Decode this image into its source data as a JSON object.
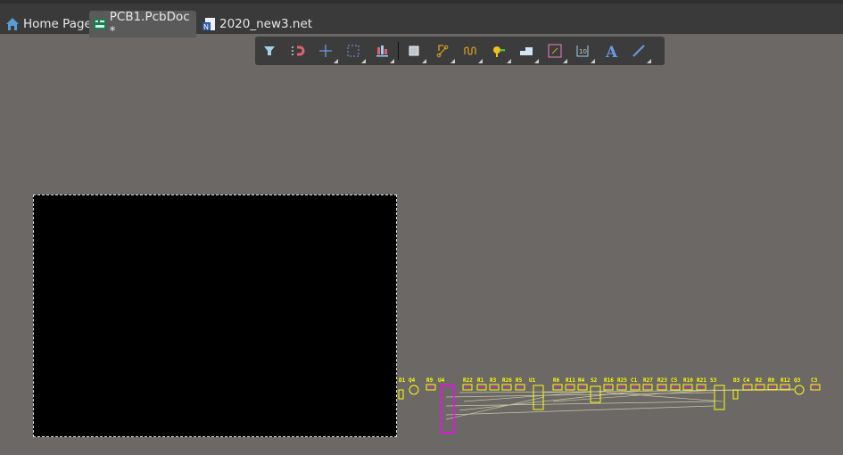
{
  "tabs": [
    {
      "label": "Home Page",
      "icon": "home-icon",
      "active": false
    },
    {
      "label": "PCB1.PcbDoc *",
      "icon": "pcb-document-icon",
      "active": true
    },
    {
      "label": "2020_new3.net",
      "icon": "netlist-document-icon",
      "active": false
    }
  ],
  "toolbar": [
    {
      "icon": "filter-icon",
      "dropdown": false
    },
    {
      "icon": "interactive-routing-magnet-icon",
      "dropdown": false
    },
    {
      "icon": "crosshair-icon",
      "dropdown": true
    },
    {
      "icon": "select-rectangle-icon",
      "dropdown": true
    },
    {
      "icon": "align-icon",
      "dropdown": true
    },
    {
      "icon": "component-icon",
      "dropdown": true
    },
    {
      "icon": "route-icon",
      "dropdown": true
    },
    {
      "icon": "length-tuning-icon",
      "dropdown": true
    },
    {
      "icon": "via-pad-icon",
      "dropdown": true
    },
    {
      "icon": "polygon-pour-icon",
      "dropdown": true
    },
    {
      "icon": "track-icon",
      "dropdown": true
    },
    {
      "icon": "dimension-icon",
      "dropdown": true
    },
    {
      "icon": "text-icon",
      "dropdown": false
    },
    {
      "icon": "line-icon",
      "dropdown": true
    }
  ],
  "components": [
    "D1",
    "Q4",
    "R9",
    "U4",
    "R22",
    "R1",
    "R3",
    "R26",
    "R5",
    "U1",
    "R6",
    "R11",
    "R4",
    "S2",
    "R16",
    "R25",
    "C1",
    "R27",
    "R23",
    "C5",
    "R10",
    "R21",
    "S3",
    "D3",
    "C4",
    "R2",
    "R8",
    "R12",
    "Q3",
    "C3"
  ],
  "colors": {
    "designator": "#ffff00",
    "board": "#000000",
    "ratsnest": "#c8c8a0",
    "pad": "#ff00ff",
    "canvas": "#6b6866"
  }
}
